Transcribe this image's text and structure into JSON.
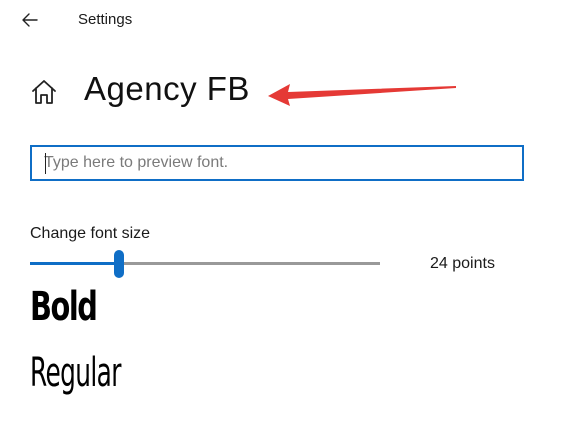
{
  "header": {
    "title": "Settings",
    "back_icon": "back-arrow-icon"
  },
  "font": {
    "name": "Agency FB",
    "home_icon": "home-icon"
  },
  "annotation": {
    "color": "#e53935"
  },
  "preview": {
    "placeholder": "Type here to preview font.",
    "value": ""
  },
  "size": {
    "label": "Change font size",
    "value_text": "24 points",
    "slider_fraction": 0.255,
    "accent_color": "#0f6ec6"
  },
  "samples": {
    "bold": "Bold",
    "regular": "Regular"
  }
}
